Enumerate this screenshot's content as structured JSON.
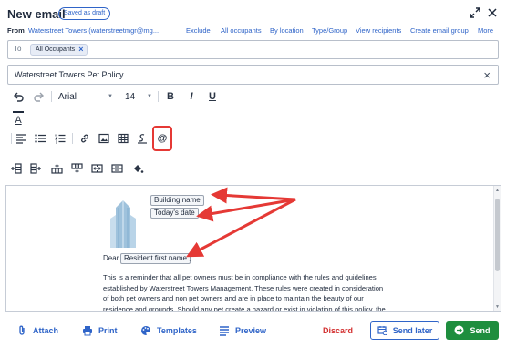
{
  "header": {
    "title": "New email",
    "draft_badge": "Saved as draft",
    "icons": [
      "expand-icon",
      "close-icon"
    ]
  },
  "from_row": {
    "label": "From",
    "sender": "Waterstreet Towers (waterstreetmgr@mg...",
    "links": [
      "Exclude",
      "All occupants",
      "By location",
      "Type/Group",
      "View recipients",
      "Create email group",
      "More"
    ]
  },
  "to_field": {
    "label": "To",
    "chip": "All Occupants"
  },
  "subject": {
    "value": "Waterstreet Towers Pet Policy"
  },
  "toolbar": {
    "font": "Arial",
    "size": "14",
    "buttons": [
      "undo-icon",
      "redo-icon",
      "bold-icon",
      "italic-icon",
      "underline-icon",
      "text-color-icon",
      "align-icon",
      "bullet-list-icon",
      "numbered-list-icon",
      "link-icon",
      "image-icon",
      "table-icon",
      "signature-icon",
      "mention-icon",
      "insert-column-icon",
      "insert-row-icon",
      "insert-row-below-icon",
      "insert-column-right-icon",
      "merge-cells-icon",
      "split-cells-icon",
      "cell-fill-icon"
    ],
    "bold": "B",
    "italic": "I",
    "underline": "U",
    "text_color": "A",
    "mention": "@"
  },
  "editor": {
    "placeholders": [
      "Building name",
      "Today's date",
      "Resident first name"
    ],
    "dear": "Dear",
    "dear_suffix": ",",
    "body_lines": [
      "This is a reminder that all pet owners must be in compliance with the rules and guidelines",
      "established by Waterstreet Towers Management. These rules were created in consideration",
      "of both pet owners and non pet owners and are in place to maintain the beauty of our",
      "residence and grounds. Should any pet create a hazard or exist in violation of this policy, the"
    ]
  },
  "footer": {
    "attach": "Attach",
    "print": "Print",
    "templates": "Templates",
    "preview": "Preview",
    "discard": "Discard",
    "send_later": "Send later",
    "send": "Send"
  },
  "colors": {
    "accent": "#2f64c8",
    "send": "#1e8e3e",
    "discard": "#d32f2f",
    "annotation": "#e53935"
  }
}
